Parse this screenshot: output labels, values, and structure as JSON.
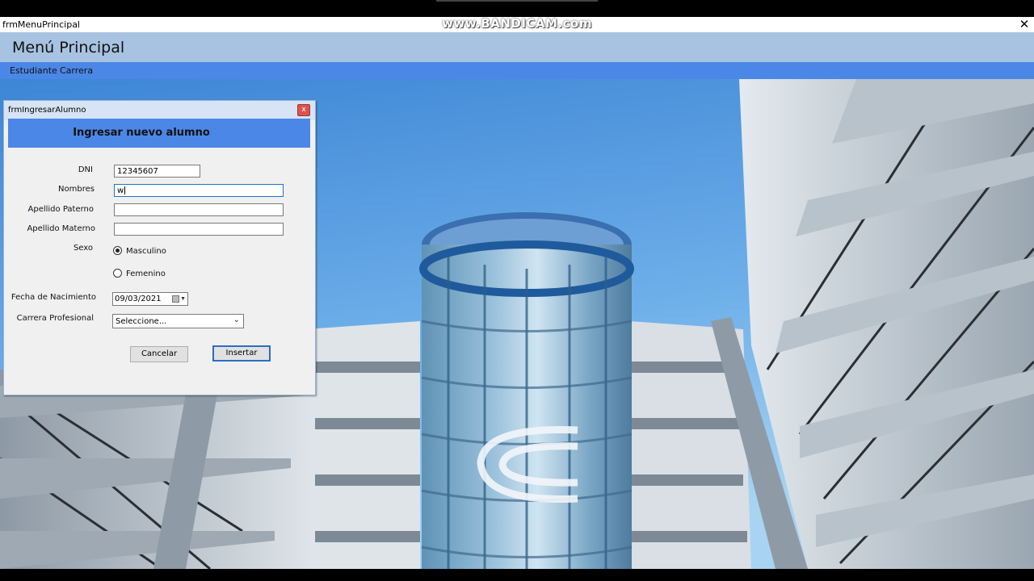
{
  "watermark": "www.BANDICAM.com",
  "window": {
    "title": "frmMenuPrincipal",
    "close_symbol": "✕"
  },
  "header": {
    "title": "Menú Principal"
  },
  "menu": {
    "items": [
      "Estudiante",
      "Carrera"
    ]
  },
  "form": {
    "window_title": "frmIngresarAlumno",
    "close_symbol": "x",
    "header_title": "Ingresar nuevo alumno",
    "labels": {
      "dni": "DNI",
      "nombres": "Nombres",
      "apellido_paterno": "Apellido Paterno",
      "apellido_materno": "Apellido Materno",
      "sexo": "Sexo",
      "fecha_nacimiento": "Fecha de Nacimiento",
      "carrera": "Carrera Profesional"
    },
    "values": {
      "dni": "12345607",
      "nombres": "w",
      "apellido_paterno": "",
      "apellido_materno": "",
      "fecha_nacimiento": "09/03/2021",
      "carrera_selected": "Seleccione..."
    },
    "sexo_options": [
      "Masculino",
      "Femenino"
    ],
    "sexo_selected": "Masculino",
    "buttons": {
      "cancel": "Cancelar",
      "insert": "Insertar"
    }
  },
  "colors": {
    "header_bg": "#a7c3e1",
    "menubar_bg": "#4b87e6",
    "form_header_bg": "#4b87e6",
    "sky": "#4a90d9"
  }
}
